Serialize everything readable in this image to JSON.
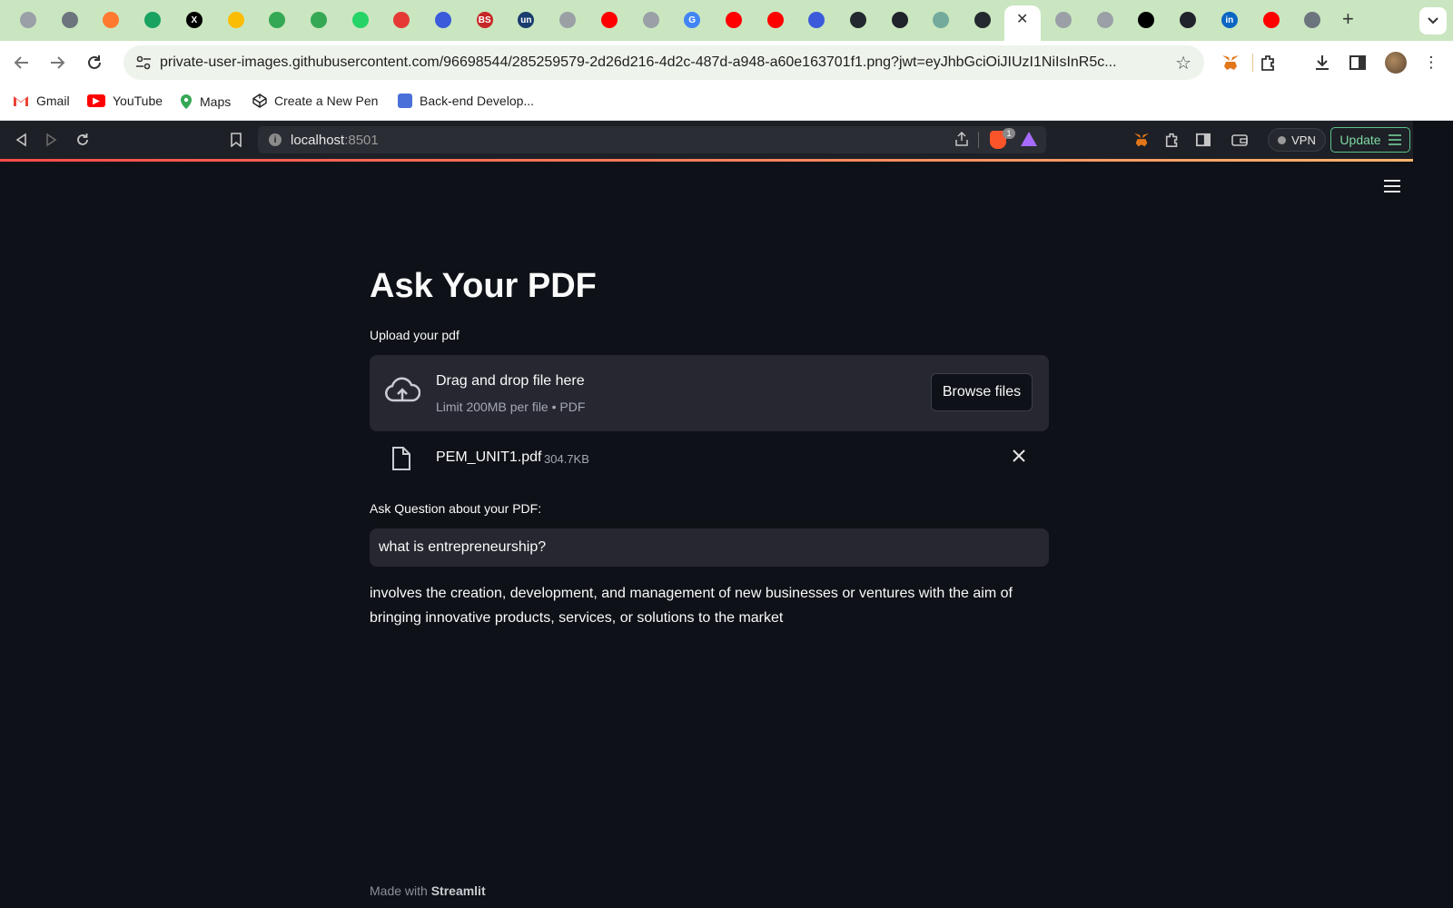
{
  "chrome": {
    "active_tab_close": "✕",
    "new_tab": "+",
    "url": "private-user-images.githubusercontent.com/96698544/285259579-2d26d216-4d2c-487d-a948-a60e163701f1.png?jwt=eyJhbGciOiJIUzI1NiIsInR5c...",
    "bookmarks": [
      {
        "label": "Gmail"
      },
      {
        "label": "YouTube"
      },
      {
        "label": "Maps"
      },
      {
        "label": "Create a New Pen"
      },
      {
        "label": "Back-end Develop..."
      }
    ],
    "tab_favicons": [
      {
        "glyph": "",
        "color": "#9aa0a6"
      },
      {
        "glyph": "",
        "color": "#6c757d"
      },
      {
        "glyph": "",
        "color": "#ff7a2f"
      },
      {
        "glyph": "",
        "color": "#1aa260"
      },
      {
        "glyph": "X",
        "color": "#000000"
      },
      {
        "glyph": "",
        "color": "#fbbc04"
      },
      {
        "glyph": "",
        "color": "#34a853"
      },
      {
        "glyph": "",
        "color": "#34a853"
      },
      {
        "glyph": "",
        "color": "#25d366"
      },
      {
        "glyph": "",
        "color": "#e53935"
      },
      {
        "glyph": "",
        "color": "#3b5bdb"
      },
      {
        "glyph": "BS",
        "color": "#c62828"
      },
      {
        "glyph": "un",
        "color": "#1a3c6e"
      },
      {
        "glyph": "",
        "color": "#9aa0a6"
      },
      {
        "glyph": "",
        "color": "#ff0000"
      },
      {
        "glyph": "",
        "color": "#9aa0a6"
      },
      {
        "glyph": "G",
        "color": "#4285f4"
      },
      {
        "glyph": "",
        "color": "#ff0000"
      },
      {
        "glyph": "",
        "color": "#ff0000"
      },
      {
        "glyph": "",
        "color": "#3b5bdb"
      },
      {
        "glyph": "",
        "color": "#24292f"
      },
      {
        "glyph": "",
        "color": "#20232a"
      },
      {
        "glyph": "",
        "color": "#74aa9c"
      },
      {
        "glyph": "",
        "color": "#24292f"
      }
    ],
    "tab_favicons_right": [
      {
        "glyph": "",
        "color": "#9aa0a6"
      },
      {
        "glyph": "",
        "color": "#9aa0a6"
      },
      {
        "glyph": "",
        "color": "#000000"
      },
      {
        "glyph": "",
        "color": "#20232a"
      },
      {
        "glyph": "in",
        "color": "#0a66c2"
      },
      {
        "glyph": "",
        "color": "#ff0000"
      },
      {
        "glyph": "",
        "color": "#6c757d"
      }
    ]
  },
  "inner_browser": {
    "host": "localhost",
    "port": ":8501",
    "shield_count": "1",
    "vpn_label": "VPN",
    "update_label": "Update"
  },
  "app": {
    "title": "Ask Your PDF",
    "upload_label": "Upload your pdf",
    "dropzone_main": "Drag and drop file here",
    "dropzone_sub": "Limit 200MB per file • PDF",
    "browse_label": "Browse files",
    "file_name": "PEM_UNIT1.pdf",
    "file_size": "304.7KB",
    "question_label": "Ask Question about your PDF:",
    "question_value": "what is entrepreneurship?",
    "answer": "involves the creation, development, and management of new businesses or ventures with the aim of bringing innovative products, services, or solutions to the market",
    "footer_prefix": "Made with",
    "footer_brand": "Streamlit"
  }
}
